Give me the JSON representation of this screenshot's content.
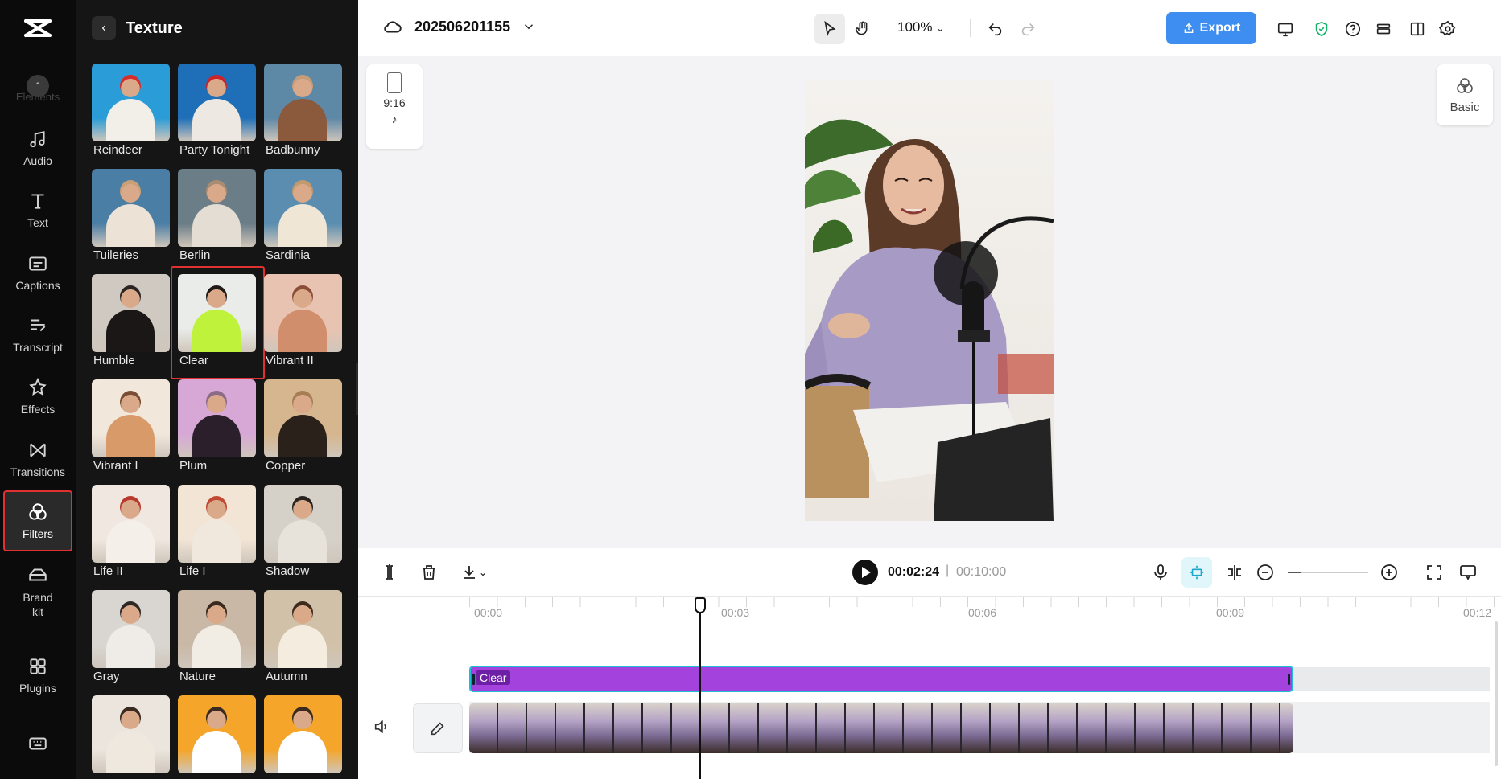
{
  "app": {
    "logo": "capcut-logo"
  },
  "rail": {
    "items": [
      {
        "id": "elements",
        "label": "Elements",
        "icon": "elements-icon"
      },
      {
        "id": "audio",
        "label": "Audio",
        "icon": "music-note-icon"
      },
      {
        "id": "text",
        "label": "Text",
        "icon": "text-icon"
      },
      {
        "id": "captions",
        "label": "Captions",
        "icon": "captions-icon"
      },
      {
        "id": "transcript",
        "label": "Transcript",
        "icon": "transcript-icon"
      },
      {
        "id": "effects",
        "label": "Effects",
        "icon": "effects-icon"
      },
      {
        "id": "transitions",
        "label": "Transitions",
        "icon": "transitions-icon"
      },
      {
        "id": "filters",
        "label": "Filters",
        "icon": "filters-icon",
        "active": true
      },
      {
        "id": "brandkit",
        "label": "Brand kit",
        "icon": "brand-kit-icon"
      },
      {
        "id": "plugins",
        "label": "Plugins",
        "icon": "plugins-icon"
      }
    ],
    "keyboard_icon": "keyboard-icon"
  },
  "panel": {
    "title": "Texture",
    "filters": [
      {
        "name": "Reindeer",
        "colors": [
          "#2a9cd8",
          "#d62c2c",
          "#f2efe9"
        ]
      },
      {
        "name": "Party Tonight",
        "colors": [
          "#1e6fb8",
          "#c9242c",
          "#ede8e2"
        ]
      },
      {
        "name": "Badbunny",
        "colors": [
          "#5d88a6",
          "#c49c7a",
          "#8b5a3c"
        ]
      },
      {
        "name": "Tuileries",
        "colors": [
          "#4b7ea4",
          "#c8a077",
          "#ece3d6"
        ]
      },
      {
        "name": "Berlin",
        "colors": [
          "#6b7d87",
          "#a88d72",
          "#e3ddd4"
        ]
      },
      {
        "name": "Sardinia",
        "colors": [
          "#5a8db0",
          "#c39a6e",
          "#efe6d5"
        ]
      },
      {
        "name": "Humble",
        "colors": [
          "#cfc9c1",
          "#2a2522",
          "#1a1716"
        ]
      },
      {
        "name": "Clear",
        "colors": [
          "#e9ece9",
          "#1f1a18",
          "#bff23a"
        ],
        "selected": true
      },
      {
        "name": "Vibrant II",
        "colors": [
          "#e9c3b1",
          "#8a4e38",
          "#d18e6c"
        ]
      },
      {
        "name": "Vibrant I",
        "colors": [
          "#f2e7db",
          "#7a4e34",
          "#d99a6a"
        ]
      },
      {
        "name": "Plum",
        "colors": [
          "#d7a8d6",
          "#8c6b86",
          "#2a1f2a"
        ]
      },
      {
        "name": "Copper",
        "colors": [
          "#d6b68e",
          "#a77d55",
          "#2a211b"
        ]
      },
      {
        "name": "Life II",
        "colors": [
          "#f0e7e0",
          "#b83a2e",
          "#f4efe8"
        ]
      },
      {
        "name": "Life I",
        "colors": [
          "#f2e5d6",
          "#c04a34",
          "#f0e8dc"
        ]
      },
      {
        "name": "Shadow",
        "colors": [
          "#d5d1c9",
          "#2a2421",
          "#e8e3da"
        ]
      },
      {
        "name": "Gray",
        "colors": [
          "#d9d6d1",
          "#2e2825",
          "#efece7"
        ]
      },
      {
        "name": "Nature",
        "colors": [
          "#c9b8a6",
          "#3a2a20",
          "#f1ece4"
        ]
      },
      {
        "name": "Autumn",
        "colors": [
          "#d2c1a9",
          "#3d2a1d",
          "#f3ecdf"
        ]
      },
      {
        "name": "",
        "colors": [
          "#ece5dd",
          "#3a2a20",
          "#efe8de"
        ]
      },
      {
        "name": "",
        "colors": [
          "#f4a52a",
          "#3a2a20",
          "#ffffff"
        ]
      },
      {
        "name": "",
        "colors": [
          "#f4a52a",
          "#3a2a20",
          "#ffffff"
        ]
      }
    ]
  },
  "topbar": {
    "project_name": "202506201155",
    "zoom": "100%",
    "export_label": "Export"
  },
  "stage": {
    "aspect_ratio": "9:16",
    "basic_label": "Basic"
  },
  "timeline_bar": {
    "current_time": "00:02:24",
    "separator": "|",
    "total_time": "00:10:00"
  },
  "timeline": {
    "ruler": [
      "00:00",
      "00:03",
      "00:06",
      "00:09",
      "00:12"
    ],
    "filter_clip_name": "Clear"
  }
}
